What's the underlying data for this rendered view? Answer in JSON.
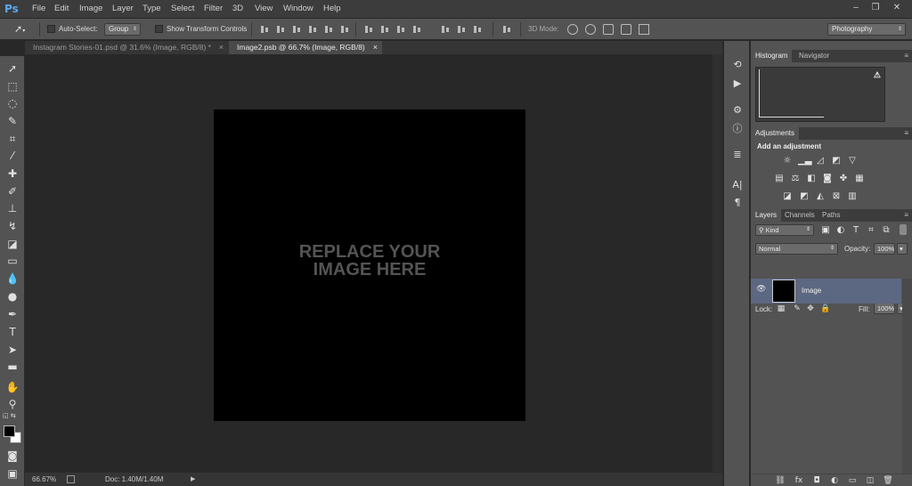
{
  "app": {
    "logo": "Ps"
  },
  "menu": [
    "File",
    "Edit",
    "Image",
    "Layer",
    "Type",
    "Select",
    "Filter",
    "3D",
    "View",
    "Window",
    "Help"
  ],
  "window_controls": {
    "minimize": "–",
    "restore": "❐",
    "close": "✕"
  },
  "options": {
    "auto_select_label": "Auto-Select:",
    "auto_select_value": "Group",
    "transform_label": "Show Transform Controls",
    "mode_3d_label": "3D Mode:",
    "workspace": "Photography"
  },
  "tabs": [
    {
      "label": "Instagram Stories-01.psd @ 31.6% (Image, RGB/8) *",
      "close": "×",
      "active": false
    },
    {
      "label": "Image2.psb @ 66.7% (Image, RGB/8)",
      "close": "×",
      "active": true
    }
  ],
  "canvas": {
    "placeholder_line1": "REPLACE YOUR",
    "placeholder_line2": "IMAGE HERE",
    "background": "#000000"
  },
  "status": {
    "zoom": "66.67%",
    "doc": "Doc: 1.40M/1.40M",
    "arrow": "▶"
  },
  "panels": {
    "histogram": {
      "tabs": [
        "Histogram",
        "Navigator"
      ],
      "warning": "⚠"
    },
    "adjustments": {
      "tab": "Adjustments",
      "title": "Add an adjustment"
    },
    "layers": {
      "tabs": [
        "Layers",
        "Channels",
        "Paths"
      ],
      "filter_kind": "Kind",
      "blend_mode": "Normal",
      "opacity_label": "Opacity:",
      "opacity_value": "100%",
      "lock_label": "Lock:",
      "fill_label": "Fill:",
      "fill_value": "100%",
      "layer_name": "Image",
      "selected_color": "#5c6781"
    }
  }
}
